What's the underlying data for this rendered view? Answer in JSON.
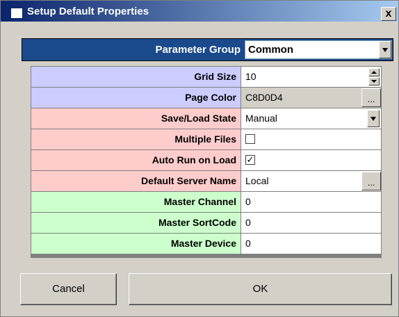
{
  "window": {
    "title": "Setup Default Properties",
    "close_label": "x"
  },
  "parameter_group": {
    "label": "Parameter Group",
    "value": "Common"
  },
  "properties": {
    "grid_size": {
      "label": "Grid Size",
      "value": "10"
    },
    "page_color": {
      "label": "Page Color",
      "value": "C8D0D4",
      "button": "..."
    },
    "save_load_state": {
      "label": "Save/Load State",
      "value": "Manual"
    },
    "multiple_files": {
      "label": "Multiple Files",
      "checked": false,
      "mark": ""
    },
    "auto_run_on_load": {
      "label": "Auto Run on Load",
      "checked": true,
      "mark": "✓"
    },
    "default_server_name": {
      "label": "Default Server Name",
      "value": "Local",
      "button": "..."
    },
    "master_channel": {
      "label": "Master Channel",
      "value": "0"
    },
    "master_sortcode": {
      "label": "Master SortCode",
      "value": "0"
    },
    "master_device": {
      "label": "Master Device",
      "value": "0"
    }
  },
  "buttons": {
    "cancel": "Cancel",
    "ok": "OK"
  },
  "colors": {
    "title_bar": "#0a246a",
    "param_header": "#1a4a8c",
    "row_blue": "#ccccff",
    "row_pink": "#ffcccc",
    "row_green": "#ccffcc",
    "dialog_bg": "#d4d0c8"
  }
}
